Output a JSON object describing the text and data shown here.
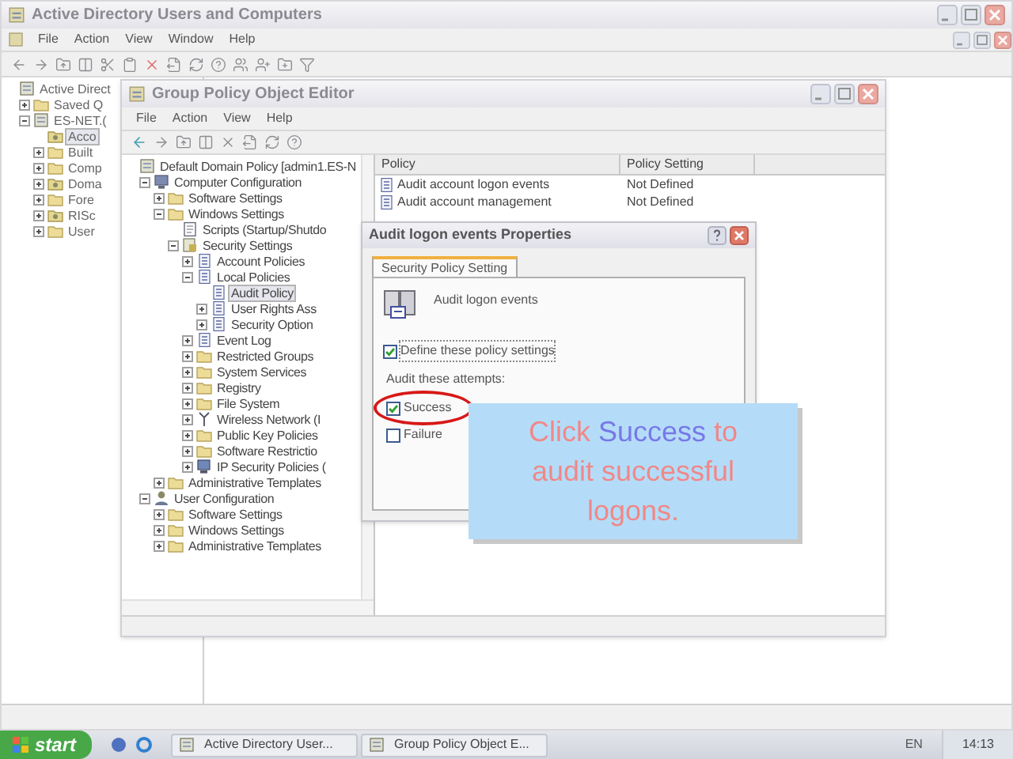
{
  "aduc": {
    "title": "Active Directory Users and Computers",
    "menu": [
      "File",
      "Action",
      "View",
      "Window",
      "Help"
    ],
    "tree": [
      {
        "label": "Active Direct",
        "kind": "root",
        "selected": false,
        "children": [
          {
            "label": "Saved Q",
            "kind": "folder",
            "expanded": false,
            "selected": false
          },
          {
            "label": "ES-NET.(",
            "kind": "domain",
            "expanded": true,
            "selected": false,
            "children": [
              {
                "label": "Acco",
                "kind": "ou",
                "selected": true
              },
              {
                "label": "Built",
                "kind": "folder",
                "expanded": false,
                "selected": false
              },
              {
                "label": "Comp",
                "kind": "folder",
                "expanded": false,
                "selected": false
              },
              {
                "label": "Doma",
                "kind": "ou",
                "expanded": false,
                "selected": false
              },
              {
                "label": "Fore",
                "kind": "folder",
                "expanded": false,
                "selected": false
              },
              {
                "label": "RISc",
                "kind": "ou",
                "expanded": false,
                "selected": false
              },
              {
                "label": "User",
                "kind": "folder",
                "expanded": false,
                "selected": false
              }
            ]
          }
        ]
      }
    ]
  },
  "gpo": {
    "title": "Group Policy Object Editor",
    "menu": [
      "File",
      "Action",
      "View",
      "Help"
    ],
    "tree": [
      {
        "label": "Default Domain Policy [admin1.ES-N",
        "kind": "root",
        "selected": false,
        "children": [
          {
            "label": "Computer Configuration",
            "kind": "computer",
            "expanded": true,
            "selected": false,
            "children": [
              {
                "label": "Software Settings",
                "kind": "folder",
                "expanded": false,
                "selected": false
              },
              {
                "label": "Windows Settings",
                "kind": "folder",
                "expanded": true,
                "selected": false,
                "children": [
                  {
                    "label": "Scripts (Startup/Shutdo",
                    "kind": "script",
                    "selected": false
                  },
                  {
                    "label": "Security Settings",
                    "kind": "security",
                    "expanded": true,
                    "selected": false,
                    "children": [
                      {
                        "label": "Account Policies",
                        "kind": "policy",
                        "expanded": false,
                        "selected": false
                      },
                      {
                        "label": "Local Policies",
                        "kind": "policy",
                        "expanded": true,
                        "selected": false,
                        "children": [
                          {
                            "label": "Audit Policy",
                            "kind": "policy",
                            "selected": true
                          },
                          {
                            "label": "User Rights Ass",
                            "kind": "policy",
                            "expanded": false,
                            "selected": false
                          },
                          {
                            "label": "Security Option",
                            "kind": "policy",
                            "expanded": false,
                            "selected": false
                          }
                        ]
                      },
                      {
                        "label": "Event Log",
                        "kind": "policy",
                        "expanded": false,
                        "selected": false
                      },
                      {
                        "label": "Restricted Groups",
                        "kind": "folder",
                        "expanded": false,
                        "selected": false
                      },
                      {
                        "label": "System Services",
                        "kind": "folder",
                        "expanded": false,
                        "selected": false
                      },
                      {
                        "label": "Registry",
                        "kind": "folder",
                        "expanded": false,
                        "selected": false
                      },
                      {
                        "label": "File System",
                        "kind": "folder",
                        "expanded": false,
                        "selected": false
                      },
                      {
                        "label": "Wireless Network (I",
                        "kind": "antenna",
                        "expanded": false,
                        "selected": false
                      },
                      {
                        "label": "Public Key Policies",
                        "kind": "folder",
                        "expanded": false,
                        "selected": false
                      },
                      {
                        "label": "Software Restrictio",
                        "kind": "folder",
                        "expanded": false,
                        "selected": false
                      },
                      {
                        "label": "IP Security Policies (",
                        "kind": "ip",
                        "expanded": false,
                        "selected": false
                      }
                    ]
                  }
                ]
              },
              {
                "label": "Administrative Templates",
                "kind": "folder",
                "expanded": false,
                "selected": false
              }
            ]
          },
          {
            "label": "User Configuration",
            "kind": "user",
            "expanded": true,
            "selected": false,
            "children": [
              {
                "label": "Software Settings",
                "kind": "folder",
                "expanded": false,
                "selected": false
              },
              {
                "label": "Windows Settings",
                "kind": "folder",
                "expanded": false,
                "selected": false
              },
              {
                "label": "Administrative Templates",
                "kind": "folder",
                "expanded": false,
                "selected": false
              }
            ]
          }
        ]
      }
    ],
    "list": {
      "columns": [
        "Policy",
        "Policy Setting"
      ],
      "rows": [
        {
          "policy": "Audit account logon events",
          "setting": "Not Defined"
        },
        {
          "policy": "Audit account management",
          "setting": "Not Defined"
        }
      ]
    }
  },
  "dialog": {
    "title": "Audit logon events Properties",
    "tabs": [
      {
        "label": "Security Policy Setting",
        "selected": true
      }
    ],
    "policy_name": "Audit logon events",
    "define": {
      "label": "Define these policy settings",
      "checked": true
    },
    "attempts_label": "Audit these attempts:",
    "attempts": [
      {
        "label": "Success",
        "checked": true,
        "circled": true
      },
      {
        "label": "Failure",
        "checked": false,
        "circled": false
      }
    ]
  },
  "callout": {
    "parts": [
      {
        "text": "Click",
        "highlight": false
      },
      {
        "text": "Success",
        "highlight": true
      },
      {
        "text": "to audit successful logons.",
        "highlight": false
      }
    ]
  },
  "taskbar": {
    "start": "start",
    "tasks": [
      "Active Directory User...",
      "Group Policy Object E..."
    ],
    "language": "EN",
    "clock": "14:13"
  }
}
